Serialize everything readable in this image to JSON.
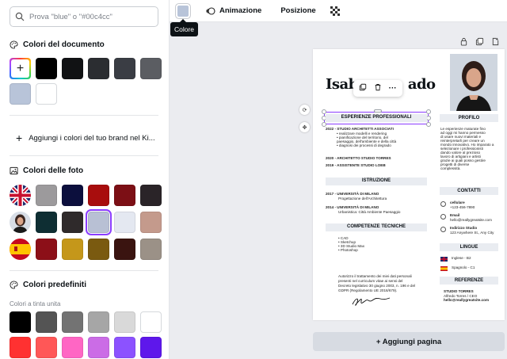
{
  "search": {
    "placeholder": "Prova \"blue\" o \"#00c4cc\""
  },
  "document_colors": {
    "title": "Colori del documento",
    "swatches": [
      "#000000",
      "#111214",
      "#2b2d31",
      "#3a3d44",
      "#5b5d62",
      "#b8c4d9",
      "#ffffff"
    ],
    "add_icon": "plus-icon"
  },
  "brand": {
    "label": "Aggiungi i colori del tuo brand nel Ki..."
  },
  "photo_colors": {
    "title": "Colori delle foto",
    "rows": [
      [
        "#9c9a9c",
        "#0c0f3d",
        "#a80d0d",
        "#7c0f15",
        "#2a2428"
      ],
      [
        "#0e2e33",
        "#2f2a2b",
        "#b8c0d4",
        "#e4e8f1",
        "#c49a8c"
      ],
      [
        "#8c0f18",
        "#c5971a",
        "#7a5a10",
        "#3a1410",
        "#9b9187"
      ]
    ]
  },
  "preset_colors": {
    "title": "Colori predefiniti",
    "subtitle": "Colori a tinta unita",
    "rows": [
      [
        "#000000",
        "#545454",
        "#737373",
        "#a6a6a6",
        "#d9d9d9",
        "#ffffff"
      ],
      [
        "#ff3131",
        "#ff5757",
        "#ff66c4",
        "#cb6ce6",
        "#8c52ff",
        "#5e17eb"
      ]
    ]
  },
  "toolbar": {
    "color_value": "#b8c4d9",
    "animation_label": "Animazione",
    "position_label": "Posizione",
    "tooltip": "Colore"
  },
  "resume": {
    "name_part1": "Isab",
    "name_part2": "ado",
    "experience_title": "ESPERIENZE PROFESSIONALI",
    "exp1_head": "2022 - STUDIO ARCHITETTI ASSOCIATI",
    "exp1_bullets": [
      "• realizzare modelli e rendering",
      "• pianificazione del territorio, del",
      "  paesaggio, dell'ambiente e della città",
      "• diagnosi dei processi di degrado"
    ],
    "exp2_head": "2020 - ARCHITETTO STUDIO TORRES",
    "exp3_head": "2019 - ASSISTENTE STUDIO LOEB",
    "education_title": "ISTRUZIONE",
    "edu1_head": "2017 - UNIVERSITÀ DI MILANO",
    "edu1_sub": "Progettazione dell'Architettura",
    "edu2_head": "2014 - UNIVERSITÀ DI MILANO",
    "edu2_sub": "Urbanistica: Città Ambiente Paesaggio",
    "skills_title": "COMPETENZE TECNICHE",
    "skills": [
      "• CAD",
      "• Sketchup",
      "• 3D Studio Max",
      "• Photoshop"
    ],
    "consent": [
      "Autorizzo il trattamento dei miei dati personali",
      "presenti nel curriculum vitae ai sensi del",
      "Decreto legislativo 30 giugno 2003, n. 196 e del",
      "GDPR (Regolamento UE 2016/679)."
    ],
    "profile_title": "PROFILO",
    "profile_text": [
      "Le esperienze maturate fino",
      "ad oggi mi hanno permesso",
      "di usare nuovi materiali e",
      "reinterpretarli per creare un",
      "mondo innovativo. Ho imparato a",
      "selezionare i professionisti",
      "dando valore al prezioso",
      "lavoro di artigiani e artisti",
      "grazie ai quali posso gestire",
      "progetti di diverse",
      "complessità."
    ],
    "contacts_title": "CONTATTI",
    "phone_label": "cellulare",
    "phone_value": "+123-456-7890",
    "email_label": "Email",
    "email_value": "hello@reallygreatsite.com",
    "address_label": "Indirizzo Studio",
    "address_value": "123 Anywhere St., Any City",
    "languages_title": "LINGUE",
    "lang1": "Inglese - B2",
    "lang2": "Spagnolo - C1",
    "references_title": "REFERENZE",
    "ref_name": "STUDIO TORRES",
    "ref_role": "Alfredo Torres / CEO",
    "ref_email": "hello@reallygreatsite.com"
  },
  "add_page_label": "+ Aggiungi pagina"
}
